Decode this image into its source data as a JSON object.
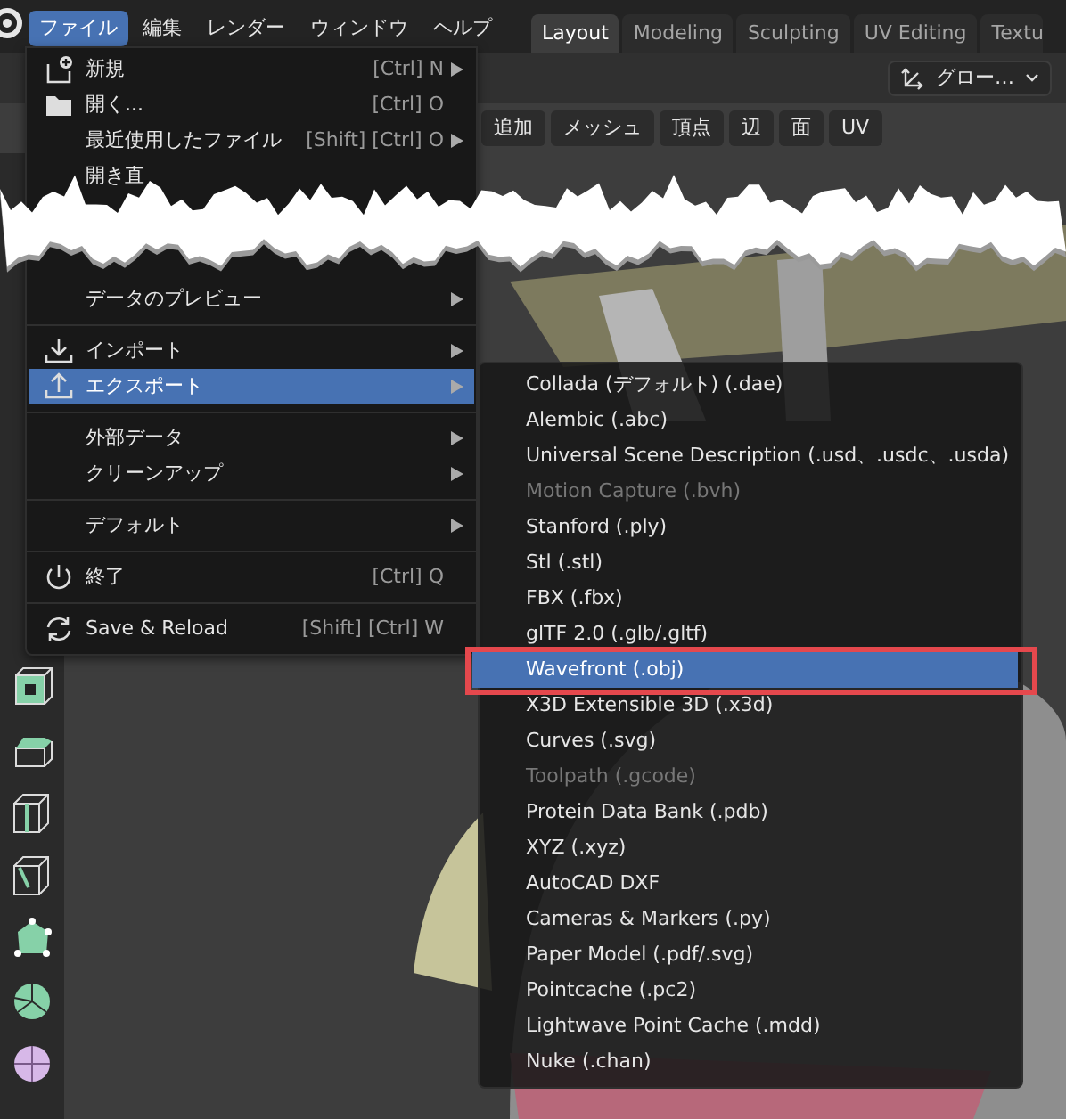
{
  "top_bar": {
    "menus": [
      {
        "label": "ファイル",
        "selected": true
      },
      {
        "label": "編集",
        "selected": false
      },
      {
        "label": "レンダー",
        "selected": false
      },
      {
        "label": "ウィンドウ",
        "selected": false
      },
      {
        "label": "ヘルプ",
        "selected": false
      }
    ],
    "workspace_tabs": [
      {
        "label": "Layout",
        "selected": true
      },
      {
        "label": "Modeling",
        "selected": false
      },
      {
        "label": "Sculpting",
        "selected": false
      },
      {
        "label": "UV Editing",
        "selected": false
      },
      {
        "label": "Textu",
        "selected": false
      }
    ]
  },
  "header": {
    "orientation": "グロー…",
    "menus": [
      "追加",
      "メッシュ",
      "頂点",
      "辺",
      "面",
      "UV"
    ]
  },
  "file_menu": {
    "top_items": [
      {
        "label": "新規",
        "shortcut": "[Ctrl] N",
        "submenu": true,
        "selected": false
      },
      {
        "label": "開く...",
        "shortcut": "[Ctrl] O",
        "submenu": false,
        "selected": false
      },
      {
        "label": "最近使用したファイル",
        "shortcut": "[Shift] [Ctrl] O",
        "submenu": true,
        "selected": false
      },
      {
        "label": "開き直",
        "submenu": false,
        "selected": false
      }
    ],
    "groups": [
      [
        {
          "label": "データのプレビュー",
          "submenu": true,
          "selected": false
        }
      ],
      [
        {
          "label": "インポート",
          "submenu": true,
          "selected": false
        },
        {
          "label": "エクスポート",
          "submenu": true,
          "selected": true
        }
      ],
      [
        {
          "label": "外部データ",
          "submenu": true,
          "selected": false
        },
        {
          "label": "クリーンアップ",
          "submenu": true,
          "selected": false
        }
      ],
      [
        {
          "label": "デフォルト",
          "submenu": true,
          "selected": false
        }
      ],
      [
        {
          "label": "終了",
          "shortcut": "[Ctrl] Q",
          "submenu": false,
          "selected": false
        }
      ],
      [
        {
          "label": "Save & Reload",
          "shortcut": "[Shift] [Ctrl] W",
          "submenu": false,
          "selected": false
        }
      ]
    ]
  },
  "export_menu": {
    "items": [
      {
        "label": "Collada (デフォルト) (.dae)",
        "disabled": false,
        "selected": false,
        "outlined": false
      },
      {
        "label": "Alembic (.abc)",
        "disabled": false,
        "selected": false,
        "outlined": false
      },
      {
        "label": "Universal Scene Description (.usd、.usdc、.usda)",
        "disabled": false,
        "selected": false,
        "outlined": false
      },
      {
        "label": "Motion Capture (.bvh)",
        "disabled": true,
        "selected": false,
        "outlined": false
      },
      {
        "label": "Stanford (.ply)",
        "disabled": false,
        "selected": false,
        "outlined": false
      },
      {
        "label": "Stl (.stl)",
        "disabled": false,
        "selected": false,
        "outlined": false
      },
      {
        "label": "FBX (.fbx)",
        "disabled": false,
        "selected": false,
        "outlined": false
      },
      {
        "label": "glTF 2.0 (.glb/.gltf)",
        "disabled": false,
        "selected": false,
        "outlined": false
      },
      {
        "label": "Wavefront (.obj)",
        "disabled": false,
        "selected": true,
        "outlined": true
      },
      {
        "label": "X3D Extensible 3D (.x3d)",
        "disabled": false,
        "selected": false,
        "outlined": false
      },
      {
        "label": "Curves (.svg)",
        "disabled": false,
        "selected": false,
        "outlined": false
      },
      {
        "label": "Toolpath (.gcode)",
        "disabled": true,
        "selected": false,
        "outlined": false
      },
      {
        "label": "Protein Data Bank (.pdb)",
        "disabled": false,
        "selected": false,
        "outlined": false
      },
      {
        "label": "XYZ (.xyz)",
        "disabled": false,
        "selected": false,
        "outlined": false
      },
      {
        "label": "AutoCAD DXF",
        "disabled": false,
        "selected": false,
        "outlined": false
      },
      {
        "label": "Cameras & Markers (.py)",
        "disabled": false,
        "selected": false,
        "outlined": false
      },
      {
        "label": "Paper Model (.pdf/.svg)",
        "disabled": false,
        "selected": false,
        "outlined": false
      },
      {
        "label": "Pointcache (.pc2)",
        "disabled": false,
        "selected": false,
        "outlined": false
      },
      {
        "label": "Lightwave Point Cache (.mdd)",
        "disabled": false,
        "selected": false,
        "outlined": false
      },
      {
        "label": "Nuke (.chan)",
        "disabled": false,
        "selected": false,
        "outlined": false
      }
    ]
  }
}
